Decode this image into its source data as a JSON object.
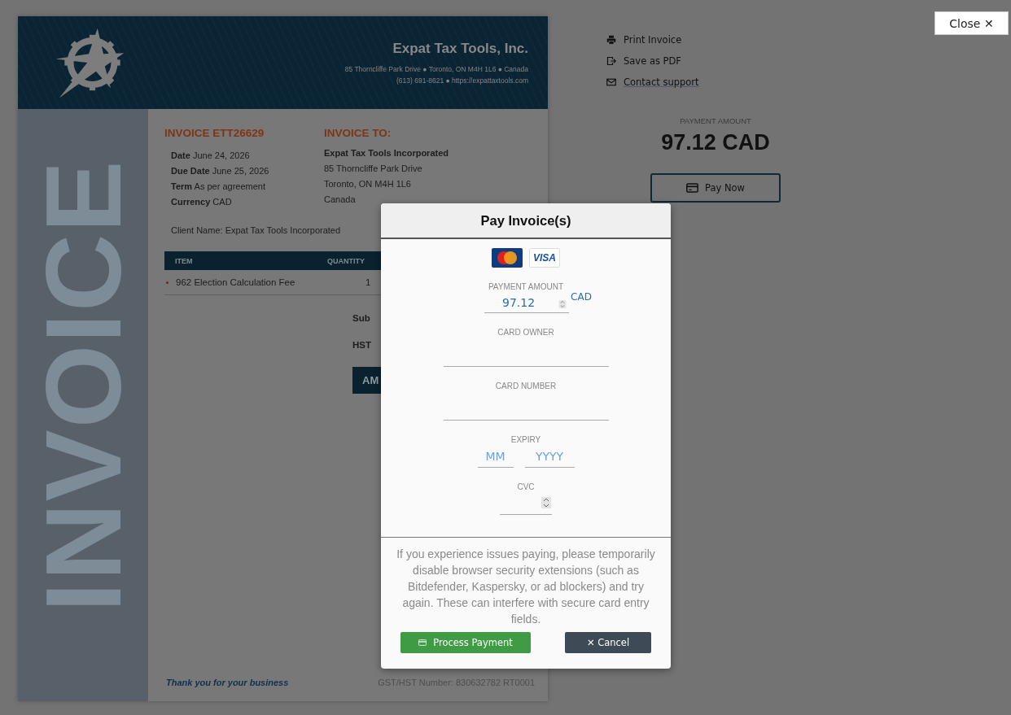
{
  "header": {
    "company": "Expat Tax Tools, Inc.",
    "address_line": "85 Thorncliffe Park Drive ● Toronto, ON M4H 1L6 ● Canada",
    "contact_line": "(613) 691-8621 ● https://expattaxtools.com"
  },
  "side_band": {
    "text": "INVOICE"
  },
  "invoice": {
    "number": "INVOICE ETT26629",
    "details": [
      {
        "label": "Date",
        "value": "June 24, 2026"
      },
      {
        "label": "Due Date",
        "value": "June 25, 2026"
      },
      {
        "label": "Term",
        "value": "As per agreement"
      },
      {
        "label": "Currency",
        "value": "CAD"
      }
    ],
    "bill_to": {
      "heading": "INVOICE TO:",
      "name": "Expat Tax Tools Incorporated",
      "lines": [
        "85 Thorncliffe Park Drive",
        "Toronto, ON  M4H 1L6",
        "Canada"
      ]
    },
    "client_name": "Client Name: Expat Tax Tools Incorporated",
    "table": {
      "columns": [
        "ITEM",
        "QUANTITY"
      ],
      "rows": [
        {
          "cells": [
            "962 Election Calculation Fee",
            "1"
          ]
        }
      ]
    },
    "totals": [
      {
        "kind": "line",
        "text": "Sub"
      },
      {
        "kind": "line",
        "text": "HST"
      },
      {
        "kind": "total",
        "text": "AM"
      }
    ]
  },
  "footer": {
    "thanks": "Thank you for your business",
    "tax_number": "GST/HST Number: 830632782 RT0001"
  },
  "actions": [
    {
      "kind": "print",
      "label": "Print Invoice",
      "link": false
    },
    {
      "kind": "export",
      "label": "Save as PDF",
      "link": false
    },
    {
      "kind": "mail",
      "label": "Contact support",
      "link": true
    }
  ],
  "summary": {
    "label": "PAYMENT AMOUNT",
    "amount": "97.12 CAD",
    "button": "Pay Now"
  },
  "close_button": {
    "label": "Close",
    "icon_char": "✕"
  },
  "modal": {
    "title": "Pay Invoice(s)",
    "brands": [
      {
        "kind": "mastercard"
      },
      {
        "kind": "visa",
        "text": "VISA"
      }
    ],
    "fields": [
      {
        "kind": "amount",
        "label": "PAYMENT AMOUNT",
        "value": "97.12",
        "suffix": "CAD"
      },
      {
        "kind": "text",
        "label": "CARD OWNER"
      },
      {
        "kind": "text",
        "label": "CARD NUMBER"
      },
      {
        "kind": "expiry",
        "label": "EXPIRY",
        "placeholders": [
          "MM",
          "YYYY"
        ]
      },
      {
        "kind": "number",
        "label": "CVC"
      }
    ],
    "notice": "If you experience issues paying, please temporarily disable browser security extensions (such as Bitdefender, Kaspersky, or ad blockers) and try again. These can interfere with secure card entry fields.",
    "buttons": [
      {
        "kind": "primary",
        "label": "Process Payment"
      },
      {
        "kind": "cancel",
        "label": "Cancel",
        "icon_char": "✕"
      }
    ]
  }
}
